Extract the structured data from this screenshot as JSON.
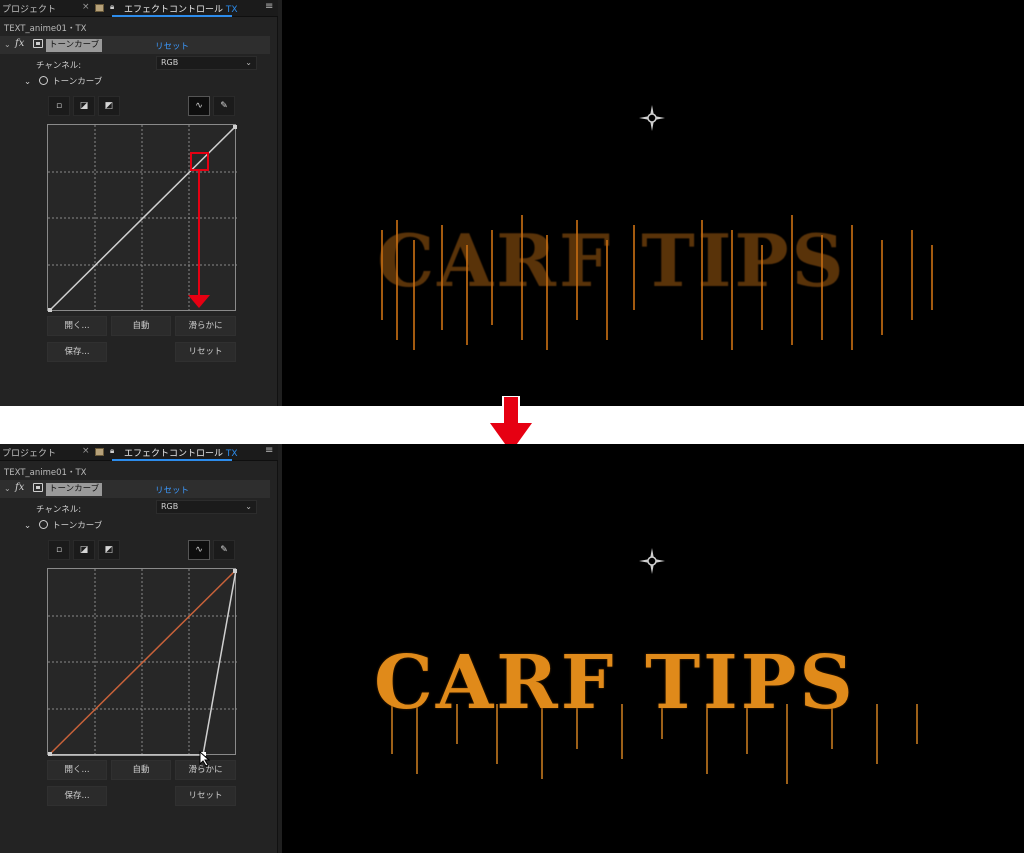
{
  "panels": [
    {
      "id": "before",
      "tabs": {
        "project": "プロジェクト",
        "effect_controls": "エフェクトコントロール",
        "effect_controls_suffix": "TX"
      },
      "layer_name": "TEXT_anime01・TX",
      "effect": {
        "fx": "fx",
        "name": "トーンカーブ",
        "reset": "リセット"
      },
      "channel": {
        "label": "チャンネル:",
        "value": "RGB"
      },
      "property": {
        "name": "トーンカーブ"
      },
      "buttons": {
        "open": "開く...",
        "auto": "自動",
        "smooth": "滑らかに",
        "save": "保存...",
        "reset": "リセット"
      },
      "viewer_text": "CARF TIPS"
    },
    {
      "id": "after",
      "tabs": {
        "project": "プロジェクト",
        "effect_controls": "エフェクトコントロール",
        "effect_controls_suffix": "TX"
      },
      "layer_name": "TEXT_anime01・TX",
      "effect": {
        "fx": "fx",
        "name": "トーンカーブ",
        "reset": "リセット"
      },
      "channel": {
        "label": "チャンネル:",
        "value": "RGB"
      },
      "property": {
        "name": "トーンカーブ"
      },
      "buttons": {
        "open": "開く...",
        "auto": "自動",
        "smooth": "滑らかに",
        "save": "保存...",
        "reset": "リセット"
      },
      "viewer_text": "CARF TIPS"
    }
  ],
  "colors": {
    "accent": "#2d8ceb",
    "annotation_red": "#e60012",
    "curve_original": "#c8623a",
    "text_fill": "#e08a1a"
  },
  "icons": [
    "close-icon",
    "lock-icon",
    "menu-icon",
    "chevron-down-icon",
    "stopwatch-icon",
    "curve-tool-icon",
    "pencil-tool-icon",
    "anchor-point-icon",
    "down-arrow-icon"
  ]
}
